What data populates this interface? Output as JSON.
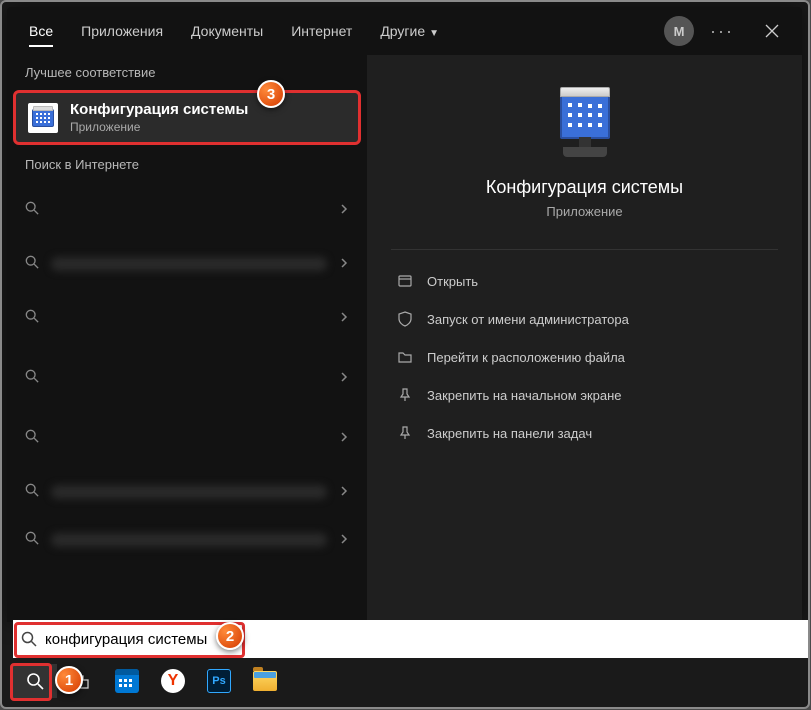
{
  "tabs": {
    "all": "Все",
    "apps": "Приложения",
    "docs": "Документы",
    "internet": "Интернет",
    "other": "Другие"
  },
  "avatar_initial": "M",
  "sections": {
    "best": "Лучшее соответствие",
    "web": "Поиск в Интернете"
  },
  "best_match": {
    "title": "Конфигурация системы",
    "subtitle": "Приложение"
  },
  "detail": {
    "title": "Конфигурация системы",
    "subtitle": "Приложение",
    "actions": {
      "open": "Открыть",
      "run_admin": "Запуск от имени администратора",
      "open_location": "Перейти к расположению файла",
      "pin_start": "Закрепить на начальном экране",
      "pin_taskbar": "Закрепить на панели задач"
    }
  },
  "search_value": "конфигурация системы",
  "badges": {
    "b1": "1",
    "b2": "2",
    "b3": "3"
  },
  "yandex_letter": "Y",
  "ps_label": "Ps"
}
